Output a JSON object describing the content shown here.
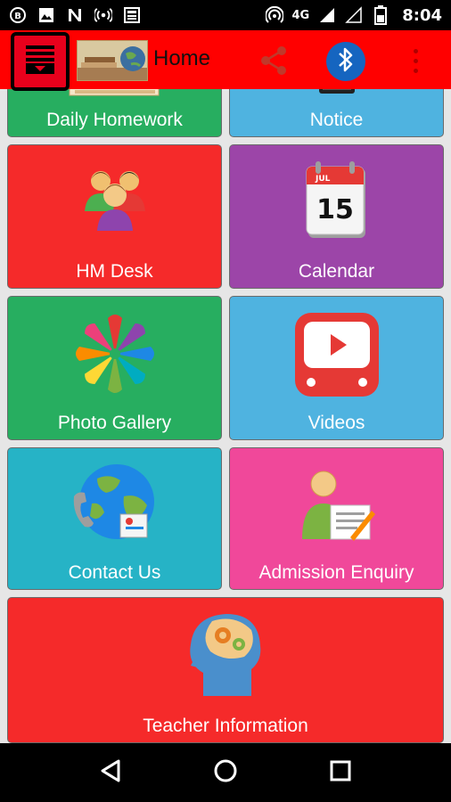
{
  "status_bar": {
    "time": "8:04",
    "network": "4G",
    "icons": [
      "b-badge-icon",
      "image-icon",
      "n-icon",
      "broadcast-icon",
      "news-icon",
      "hotspot-icon",
      "signal-icon",
      "signal-empty-icon",
      "battery-icon"
    ]
  },
  "app_bar": {
    "title": "Home",
    "menu_icon": "inbox-down-icon",
    "share_icon": "share-icon",
    "bluetooth_icon": "bluetooth-icon",
    "overflow_icon": "more-vertical-icon"
  },
  "tiles": [
    {
      "label": "Daily Homework",
      "color": "#27ae60",
      "icon": "homework-icon"
    },
    {
      "label": "Notice",
      "color": "#4fb3e0",
      "icon": "notice-icon"
    },
    {
      "label": "HM Desk",
      "color": "#f52a2a",
      "icon": "people-group-icon"
    },
    {
      "label": "Calendar",
      "color": "#9c45a8",
      "icon": "calendar-icon",
      "day": "15",
      "month": "JUL"
    },
    {
      "label": "Photo Gallery",
      "color": "#27ae60",
      "icon": "hands-flower-icon"
    },
    {
      "label": "Videos",
      "color": "#4fb3e0",
      "icon": "youtube-icon"
    },
    {
      "label": "Contact Us",
      "color": "#26b3c6",
      "icon": "globe-phone-icon"
    },
    {
      "label": "Admission Enquiry",
      "color": "#f0489a",
      "icon": "person-form-icon"
    },
    {
      "label": "Teacher Information",
      "color": "#f52a2a",
      "icon": "brain-gears-icon"
    }
  ],
  "nav_bar": {
    "back": "back-icon",
    "home": "home-icon",
    "recents": "recents-icon"
  }
}
